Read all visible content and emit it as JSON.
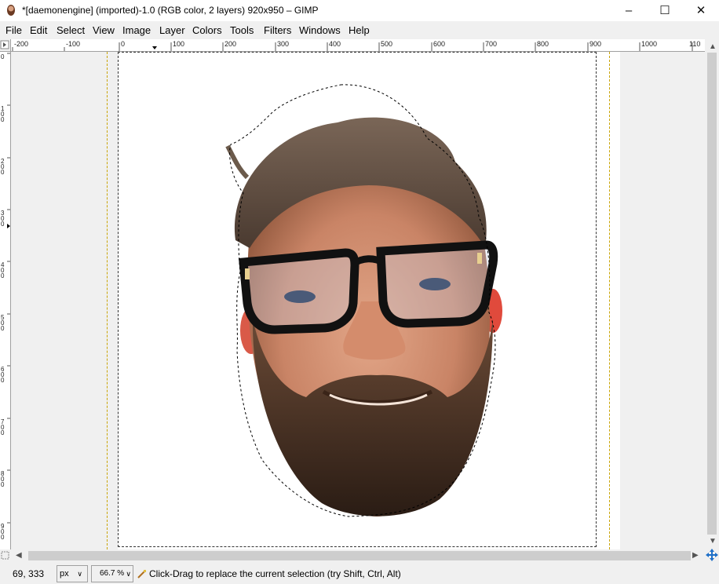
{
  "window": {
    "title": "*[daemonengine] (imported)-1.0 (RGB color, 2 layers) 920x950 – GIMP",
    "minimize": "–",
    "maximize": "☐",
    "close": "✕"
  },
  "menu": [
    {
      "label": "File"
    },
    {
      "label": "Edit"
    },
    {
      "label": "Select"
    },
    {
      "label": "View"
    },
    {
      "label": "Image"
    },
    {
      "label": "Layer"
    },
    {
      "label": "Colors"
    },
    {
      "label": "Tools"
    },
    {
      "label": "Filters"
    },
    {
      "label": "Windows"
    },
    {
      "label": "Help"
    }
  ],
  "hruler": [
    "-200",
    "-100",
    "0",
    "100",
    "200",
    "300",
    "400",
    "500",
    "600",
    "700",
    "800",
    "900",
    "1000",
    "110"
  ],
  "vruler": [
    "0",
    "1\n0\n0",
    "2\n0\n0",
    "3\n0\n0",
    "4\n0\n0",
    "5\n0\n0",
    "6\n0\n0",
    "7\n0\n0",
    "8\n0\n0",
    "9\n0\n0"
  ],
  "status": {
    "coords": "69, 333",
    "unit": "px",
    "zoom": "66.7 %",
    "message": "Click-Drag to replace the current selection (try Shift, Ctrl, Alt)"
  },
  "icons": {
    "app": "gimp-icon",
    "nav": "navigate-icon",
    "quickmask": "quick-mask-icon",
    "tool": "rect-select-icon"
  }
}
